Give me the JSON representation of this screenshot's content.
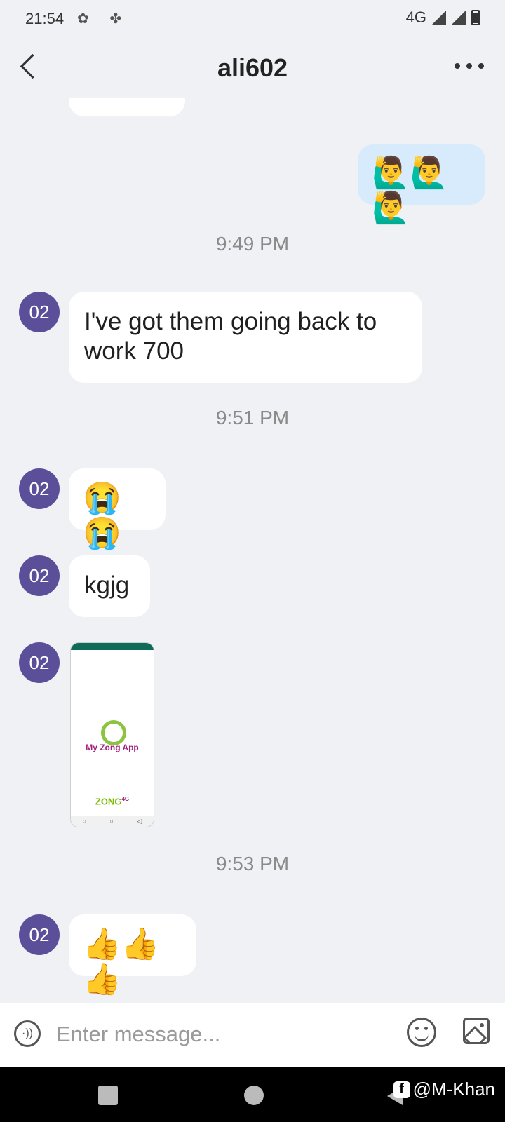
{
  "status_bar": {
    "time": "21:54",
    "network": "4G"
  },
  "header": {
    "title": "ali602"
  },
  "messages": [
    {
      "kind": "outgoing",
      "emoji": "🙋‍♂️🙋‍♂️🙋‍♂️"
    },
    {
      "kind": "timestamp",
      "text": "9:49 PM"
    },
    {
      "kind": "incoming",
      "avatar": "02",
      "text": "I've got them going back to work 700"
    },
    {
      "kind": "timestamp",
      "text": "9:51 PM"
    },
    {
      "kind": "incoming",
      "avatar": "02",
      "emoji": "😭😭"
    },
    {
      "kind": "incoming",
      "avatar": "02",
      "text": "kgjg"
    },
    {
      "kind": "incoming-image",
      "avatar": "02",
      "image_text": "My Zong App",
      "image_brand": "ZONG",
      "image_brand_sup": "4G"
    },
    {
      "kind": "timestamp",
      "text": "9:53 PM"
    },
    {
      "kind": "incoming",
      "avatar": "02",
      "emoji": "👍👍👍"
    }
  ],
  "input": {
    "placeholder": "Enter message..."
  },
  "icons": {
    "back": "chevron-left-icon",
    "more": "more-horizontal-icon",
    "voice": "voice-icon",
    "emoji": "emoji-icon",
    "image": "image-icon"
  },
  "watermark": {
    "text": "@M-Khan",
    "icon_letter": "f"
  },
  "colors": {
    "avatar": "#5c4f9a",
    "outgoing_bubble": "#d7ebfc",
    "background": "#f0f1f5"
  }
}
